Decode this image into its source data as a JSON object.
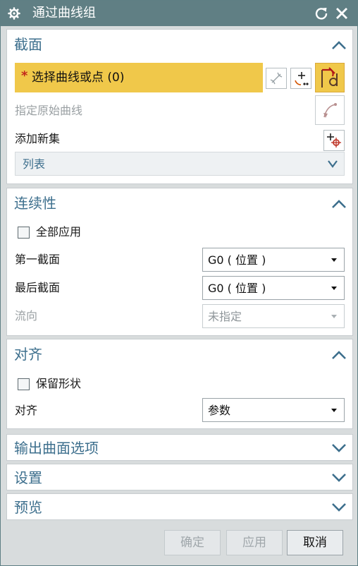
{
  "window": {
    "title": "通过曲线组"
  },
  "sections": {
    "section": {
      "title": "截面",
      "select_prompt": "选择曲线或点 (0)",
      "required_mark": "*",
      "specify_origin_label": "指定原始曲线",
      "add_new_set_label": "添加新集",
      "list_label": "列表"
    },
    "continuity": {
      "title": "连续性",
      "apply_all_label": "全部应用",
      "first_section_label": "第一截面",
      "first_section_value": "G0 ( 位置 )",
      "last_section_label": "最后截面",
      "last_section_value": "G0 ( 位置 )",
      "flow_label": "流向",
      "flow_value": "未指定"
    },
    "alignment": {
      "title": "对齐",
      "preserve_shape_label": "保留形状",
      "align_label": "对齐",
      "align_value": "参数"
    },
    "output_surface": {
      "title": "输出曲面选项"
    },
    "settings": {
      "title": "设置"
    },
    "preview": {
      "title": "预览"
    }
  },
  "footer": {
    "ok": "确定",
    "apply": "应用",
    "cancel": "取消"
  },
  "colors": {
    "titlebar": "#607f84",
    "section_title": "#3d6f8d",
    "select_highlight": "#f0c84a",
    "panel_bg": "#d8dcdd"
  },
  "icons": {
    "title": "gear-icon",
    "reset": "reset-icon",
    "close": "close-icon",
    "collapse": "chevron-up-icon",
    "expand": "chevron-down-icon"
  }
}
